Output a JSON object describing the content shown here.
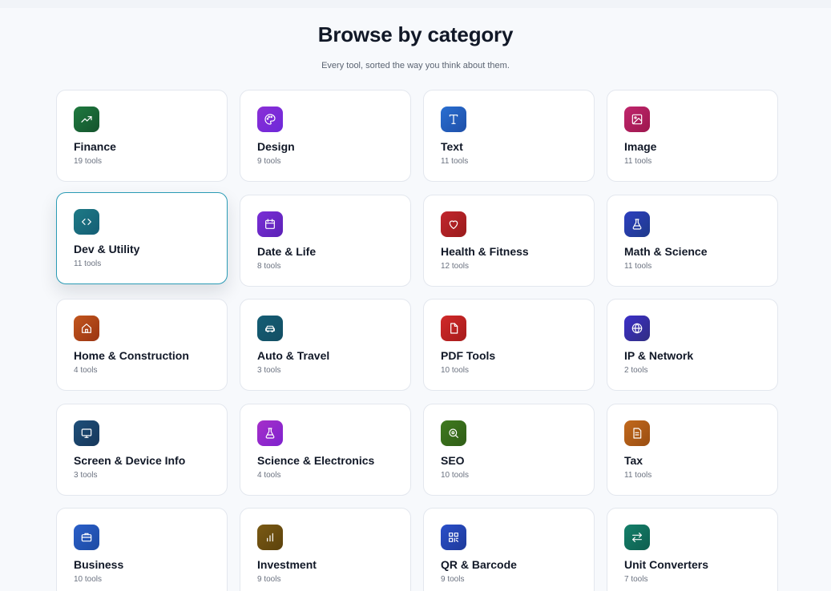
{
  "header": {
    "title": "Browse by category",
    "subtitle": "Every tool, sorted the way you think about them."
  },
  "categories": [
    {
      "label": "Finance",
      "count": "19 tools",
      "icon": "trending-up-icon",
      "colors": [
        "#1f7a3f",
        "#14532d"
      ]
    },
    {
      "label": "Design",
      "count": "9 tools",
      "icon": "palette-icon",
      "colors": [
        "#8b2fd6",
        "#6d28d9"
      ]
    },
    {
      "label": "Text",
      "count": "11 tools",
      "icon": "type-icon",
      "colors": [
        "#2a6fd1",
        "#1e4fa8"
      ]
    },
    {
      "label": "Image",
      "count": "11 tools",
      "icon": "image-icon",
      "colors": [
        "#c0266d",
        "#9d174d"
      ]
    },
    {
      "label": "Dev & Utility",
      "count": "11 tools",
      "icon": "code-icon",
      "colors": [
        "#1e7a86",
        "#155e75"
      ]
    },
    {
      "label": "Date & Life",
      "count": "8 tools",
      "icon": "calendar-icon",
      "colors": [
        "#7a2fd6",
        "#5b21b6"
      ]
    },
    {
      "label": "Health & Fitness",
      "count": "12 tools",
      "icon": "heart-icon",
      "colors": [
        "#c2262e",
        "#991b1b"
      ]
    },
    {
      "label": "Math & Science",
      "count": "11 tools",
      "icon": "flask-icon",
      "colors": [
        "#2d3fc0",
        "#1e3a8a"
      ]
    },
    {
      "label": "Home & Construction",
      "count": "4 tools",
      "icon": "home-icon",
      "colors": [
        "#c2561d",
        "#9a3412"
      ]
    },
    {
      "label": "Auto & Travel",
      "count": "3 tools",
      "icon": "car-icon",
      "colors": [
        "#155e75",
        "#134e63"
      ]
    },
    {
      "label": "PDF Tools",
      "count": "10 tools",
      "icon": "file-icon",
      "colors": [
        "#d12a2a",
        "#a61b1b"
      ]
    },
    {
      "label": "IP & Network",
      "count": "2 tools",
      "icon": "globe-icon",
      "colors": [
        "#3b2fc9",
        "#312e81"
      ]
    },
    {
      "label": "Screen & Device Info",
      "count": "3 tools",
      "icon": "monitor-icon",
      "colors": [
        "#1e4f7a",
        "#17375a"
      ]
    },
    {
      "label": "Science & Electronics",
      "count": "4 tools",
      "icon": "beaker-icon",
      "colors": [
        "#a62fc9",
        "#7e22ce"
      ]
    },
    {
      "label": "SEO",
      "count": "10 tools",
      "icon": "search-icon",
      "colors": [
        "#3f7a1f",
        "#2f5d16"
      ]
    },
    {
      "label": "Tax",
      "count": "11 tools",
      "icon": "receipt-icon",
      "colors": [
        "#c2691d",
        "#9a4e12"
      ]
    },
    {
      "label": "Business",
      "count": "10 tools",
      "icon": "briefcase-icon",
      "colors": [
        "#2a5fc9",
        "#1d4ba3"
      ]
    },
    {
      "label": "Investment",
      "count": "9 tools",
      "icon": "bar-chart-icon",
      "colors": [
        "#7a5a14",
        "#5c420c"
      ]
    },
    {
      "label": "QR & Barcode",
      "count": "9 tools",
      "icon": "qr-code-icon",
      "colors": [
        "#2a4fc9",
        "#1e3a9a"
      ]
    },
    {
      "label": "Unit Converters",
      "count": "7 tools",
      "icon": "arrows-swap-icon",
      "colors": [
        "#14806a",
        "#0f5e4f"
      ]
    }
  ]
}
